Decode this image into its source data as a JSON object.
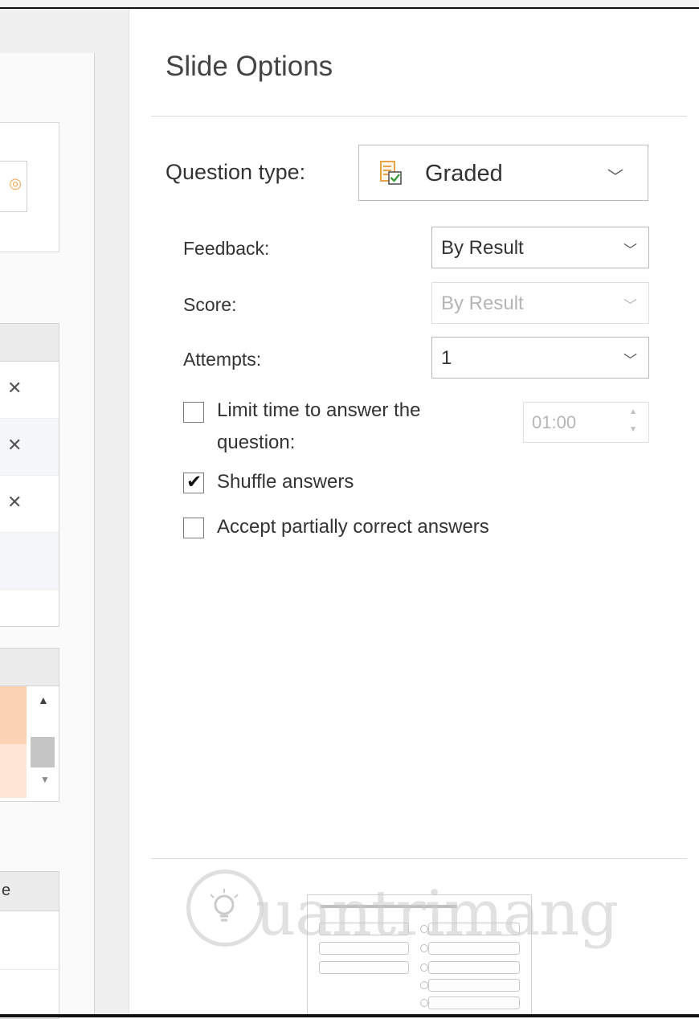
{
  "panel": {
    "title": "Slide Options"
  },
  "question_type": {
    "label": "Question type:",
    "value": "Graded",
    "icon": "graded-question-icon"
  },
  "feedback": {
    "label": "Feedback:",
    "value": "By Result"
  },
  "score": {
    "label": "Score:",
    "value": "By Result",
    "disabled": true
  },
  "attempts": {
    "label": "Attempts:",
    "value": "1"
  },
  "limit_time": {
    "label_line1": "Limit time to answer the",
    "label_line2": "question:",
    "checked": false,
    "time_value": "01:00"
  },
  "shuffle": {
    "label": "Shuffle answers",
    "checked": true
  },
  "partial": {
    "label": "Accept partially correct answers",
    "checked": false
  },
  "left_panel": {
    "row_close_glyph": "✕",
    "partial_header_char": "e"
  },
  "watermark": {
    "text": "uantrimang"
  },
  "colors": {
    "accent_peach": "#fbd2b2",
    "accent_peach_light": "#fde6d6",
    "icon_orange": "#f0a650",
    "icon_green": "#3c9a3c"
  }
}
